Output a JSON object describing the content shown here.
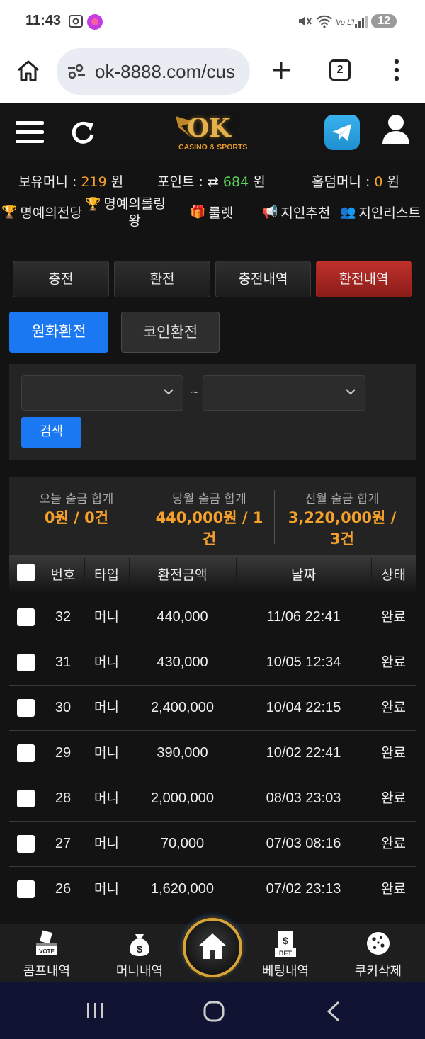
{
  "status_bar": {
    "time": "11:43",
    "battery": "12"
  },
  "browser": {
    "url": "ok-8888.com/cus",
    "tab_count": "2"
  },
  "site": {
    "logo_text": "OK",
    "logo_sub": "CASINO & SPORTS",
    "balances": [
      {
        "label": "보유머니 : ",
        "value": "219",
        "unit": " 원",
        "color": "#f5a02a"
      },
      {
        "label": "포인트 : ",
        "value": "684",
        "unit": " 원",
        "color": "#59d65a"
      },
      {
        "label": "홀덤머니 : ",
        "value": "0",
        "unit": " 원",
        "color": "#f5a02a"
      }
    ],
    "nav": [
      {
        "label": "명예의전당",
        "icon": "trophy-icon"
      },
      {
        "label_line1": "명예의롤링",
        "label_line2": "왕",
        "icon": "trophy-icon"
      },
      {
        "label": "룰렛",
        "icon": "gift-icon"
      },
      {
        "label": "지인추천",
        "icon": "megaphone-icon"
      },
      {
        "label": "지인리스트",
        "icon": "users-icon"
      }
    ]
  },
  "tabs": [
    "충전",
    "환전",
    "충전내역",
    "환전내역"
  ],
  "active_tab": "환전내역",
  "subtabs": [
    "원화환전",
    "코인환전"
  ],
  "filter": {
    "tilde": "~",
    "search_label": "검색"
  },
  "summary": [
    {
      "label": "오늘 출금 합계",
      "value": "0원 / 0건"
    },
    {
      "label": "당월 출금 합계",
      "value": "440,000원 / 1건"
    },
    {
      "label": "전월 출금 합계",
      "value": "3,220,000원 / 3건"
    }
  ],
  "table": {
    "headers": [
      "번호",
      "타입",
      "환전금액",
      "날짜",
      "상태"
    ],
    "rows": [
      {
        "no": "32",
        "type": "머니",
        "amount": "440,000",
        "date": "11/06 22:41",
        "status": "완료"
      },
      {
        "no": "31",
        "type": "머니",
        "amount": "430,000",
        "date": "10/05 12:34",
        "status": "완료"
      },
      {
        "no": "30",
        "type": "머니",
        "amount": "2,400,000",
        "date": "10/04 22:15",
        "status": "완료"
      },
      {
        "no": "29",
        "type": "머니",
        "amount": "390,000",
        "date": "10/02 22:41",
        "status": "완료"
      },
      {
        "no": "28",
        "type": "머니",
        "amount": "2,000,000",
        "date": "08/03 23:03",
        "status": "완료"
      },
      {
        "no": "27",
        "type": "머니",
        "amount": "70,000",
        "date": "07/03 08:16",
        "status": "완료"
      },
      {
        "no": "26",
        "type": "머니",
        "amount": "1,620,000",
        "date": "07/02 23:13",
        "status": "완료"
      }
    ]
  },
  "bottom_nav": [
    "콤프내역",
    "머니내역",
    "베팅내역",
    "쿠키삭제"
  ],
  "colors": {
    "accent_orange": "#f5a02a",
    "point_green": "#59d65a",
    "active_red": "#c0302b",
    "primary_blue": "#1a78f2",
    "logo_gold": "#e3b04b"
  }
}
